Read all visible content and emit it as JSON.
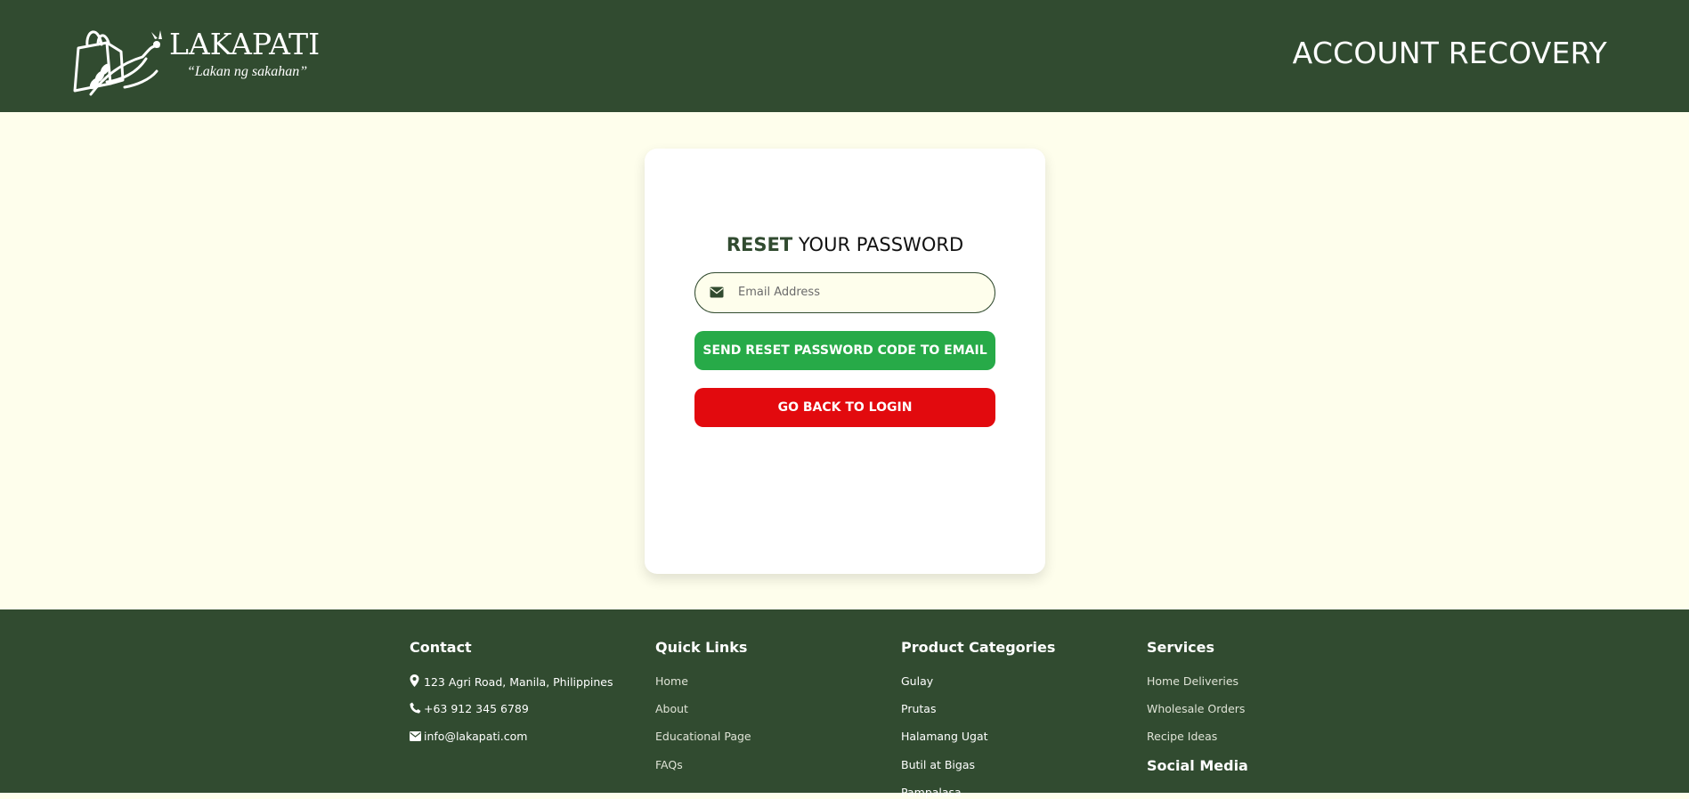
{
  "header": {
    "brand_name": "LAKAPATI",
    "tagline": "“Lakan ng sakahan”",
    "page_heading": "ACCOUNT RECOVERY"
  },
  "card": {
    "title_accent": "RESET",
    "title_rest": " YOUR PASSWORD",
    "email_placeholder": "Email Address",
    "send_button": "SEND RESET PASSWORD CODE TO EMAIL",
    "back_button": "GO BACK TO LOGIN"
  },
  "footer": {
    "contact": {
      "title": "Contact",
      "items": [
        "123 Agri Road, Manila, Philippines",
        "+63 912 345 6789",
        "info@lakapati.com"
      ]
    },
    "quick_links": {
      "title": "Quick Links",
      "items": [
        "Home",
        "About",
        "Educational Page",
        "FAQs"
      ]
    },
    "product_categories": {
      "title": "Product Categories",
      "items": [
        "Gulay",
        "Prutas",
        "Halamang Ugat",
        "Butil at Bigas",
        "Pampalasa"
      ]
    },
    "services": {
      "title": "Services",
      "items": [
        "Home Deliveries",
        "Wholesale Orders",
        "Recipe Ideas"
      ]
    },
    "social_media_title": "Social Media"
  },
  "colors": {
    "header_bg": "#314b30",
    "page_bg": "#fefeec",
    "send_button": "#27aa48",
    "back_button": "#e20a0e"
  }
}
